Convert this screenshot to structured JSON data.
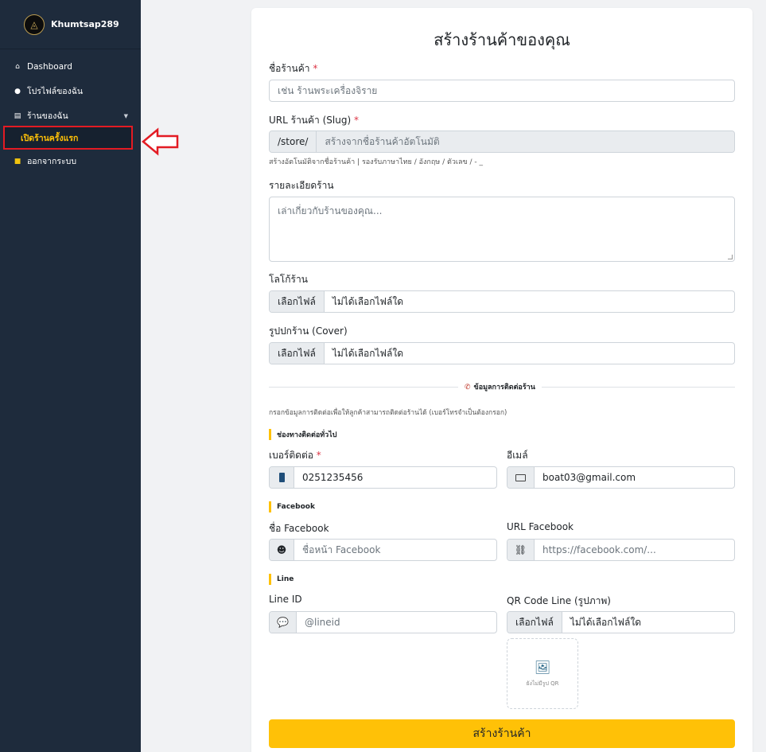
{
  "sidebar": {
    "brand_name": "Khumtsap289",
    "items": [
      {
        "label": "Dashboard",
        "icon": "home-icon"
      },
      {
        "label": "โปรไฟล์ของฉัน",
        "icon": "user-icon"
      },
      {
        "label": "ร้านของฉัน",
        "icon": "store-icon"
      },
      {
        "label": "เปิดร้านครั้งแรก"
      },
      {
        "label": "ออกจากระบบ",
        "icon": "lock-icon"
      }
    ]
  },
  "form": {
    "title": "สร้างร้านค้าของคุณ",
    "shop_name": {
      "label": "ชื่อร้านค้า",
      "required": "*",
      "placeholder": "เช่น ร้านพระเครื่องจิราย"
    },
    "slug": {
      "label": "URL ร้านค้า (Slug)",
      "required": "*",
      "prefix": "/store/",
      "placeholder": "สร้างจากชื่อร้านค้าอัตโนมัติ",
      "helper": "สร้างอัตโนมัติจากชื่อร้านค้า | รองรับภาษาไทย / อังกฤษ / ตัวเลข / - _"
    },
    "description": {
      "label": "รายละเอียดร้าน",
      "placeholder": "เล่าเกี่ยวกับร้านของคุณ..."
    },
    "logo": {
      "label": "โลโก้ร้าน",
      "button": "เลือกไฟล์",
      "status": "ไม่ได้เลือกไฟล์ใด"
    },
    "cover": {
      "label": "รูปปกร้าน (Cover)",
      "button": "เลือกไฟล์",
      "status": "ไม่ได้เลือกไฟล์ใด"
    },
    "contact_divider": "ข้อมูลการติดต่อร้าน",
    "contact_note": "กรอกข้อมูลการติดต่อเพื่อให้ลูกค้าสามารถติดต่อร้านได้ (เบอร์โทรจำเป็นต้องกรอก)",
    "general_section": "ช่องทางติดต่อทั่วไป",
    "phone": {
      "label": "เบอร์ติดต่อ",
      "required": "*",
      "value": "0251235456"
    },
    "email": {
      "label": "อีเมล์",
      "value": "boat03@gmail.com"
    },
    "facebook_section": "Facebook",
    "fb_name": {
      "label": "ชื่อ Facebook",
      "placeholder": "ชื่อหน้า Facebook"
    },
    "fb_url": {
      "label": "URL Facebook",
      "placeholder": "https://facebook.com/..."
    },
    "line_section": "Line",
    "line_id": {
      "label": "Line ID",
      "placeholder": "@lineid"
    },
    "line_qr": {
      "label": "QR Code Line (รูปภาพ)",
      "button": "เลือกไฟล์",
      "status": "ไม่ได้เลือกไฟล์ใด",
      "empty_text": "ยังไม่มีรูป QR"
    },
    "submit": "สร้างร้านค้า"
  },
  "colors": {
    "sidebar_bg": "#1e2b3c",
    "accent": "#ffc107",
    "required": "#dc3545",
    "highlight_border": "#e31b23"
  }
}
